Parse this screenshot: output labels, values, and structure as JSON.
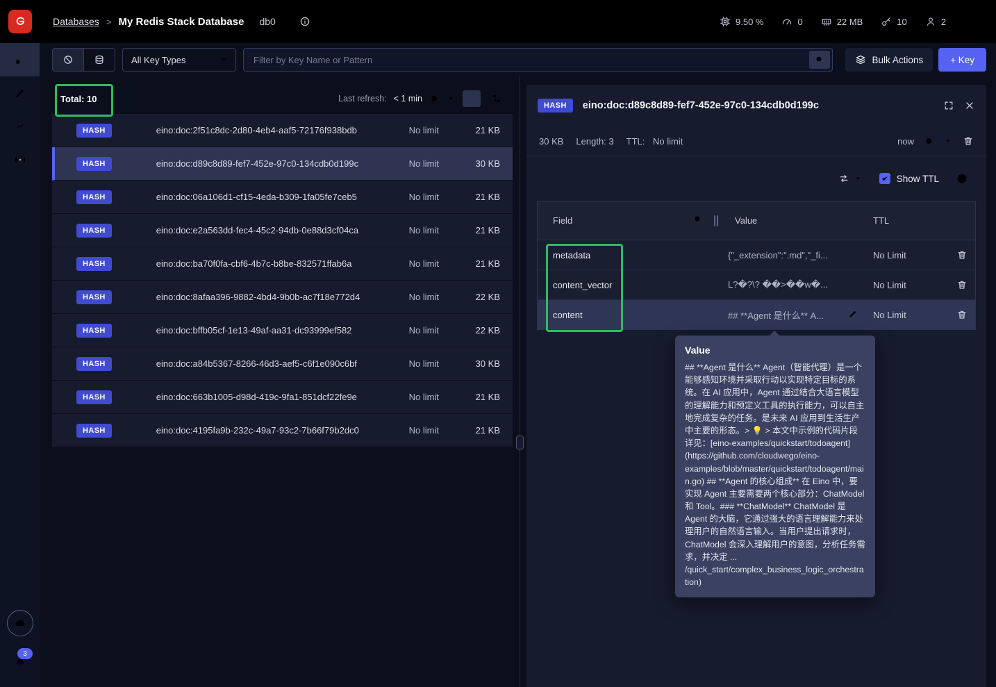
{
  "header": {
    "breadcrumb": {
      "root": "Databases",
      "separator": ">",
      "current": "My Redis Stack Database"
    },
    "db_badge": "db0",
    "metrics": {
      "cpu": "9.50 %",
      "commands": "0",
      "memory": "22 MB",
      "keys": "10",
      "clients": "2"
    }
  },
  "filter_bar": {
    "key_type_selected": "All Key Types",
    "search_placeholder": "Filter by Key Name or Pattern",
    "bulk_actions_label": "Bulk Actions",
    "add_key_label": "+ Key"
  },
  "key_list": {
    "total_label": "Total: 10",
    "last_refresh_label": "Last refresh:",
    "last_refresh_value": "< 1 min",
    "rows": [
      {
        "type": "HASH",
        "name": "eino:doc:2f51c8dc-2d80-4eb4-aaf5-72176f938bdb",
        "ttl": "No limit",
        "size": "21 KB"
      },
      {
        "type": "HASH",
        "name": "eino:doc:d89c8d89-fef7-452e-97c0-134cdb0d199c",
        "ttl": "No limit",
        "size": "30 KB"
      },
      {
        "type": "HASH",
        "name": "eino:doc:06a106d1-cf15-4eda-b309-1fa05fe7ceb5",
        "ttl": "No limit",
        "size": "21 KB"
      },
      {
        "type": "HASH",
        "name": "eino:doc:e2a563dd-fec4-45c2-94db-0e88d3cf04ca",
        "ttl": "No limit",
        "size": "21 KB"
      },
      {
        "type": "HASH",
        "name": "eino:doc:ba70f0fa-cbf6-4b7c-b8be-832571ffab6a",
        "ttl": "No limit",
        "size": "21 KB"
      },
      {
        "type": "HASH",
        "name": "eino:doc:8afaa396-9882-4bd4-9b0b-ac7f18e772d4",
        "ttl": "No limit",
        "size": "22 KB"
      },
      {
        "type": "HASH",
        "name": "eino:doc:bffb05cf-1e13-49af-aa31-dc93999ef582",
        "ttl": "No limit",
        "size": "22 KB"
      },
      {
        "type": "HASH",
        "name": "eino:doc:a84b5367-8266-46d3-aef5-c6f1e090c6bf",
        "ttl": "No limit",
        "size": "30 KB"
      },
      {
        "type": "HASH",
        "name": "eino:doc:663b1005-d98d-419c-9fa1-851dcf22fe9e",
        "ttl": "No limit",
        "size": "21 KB"
      },
      {
        "type": "HASH",
        "name": "eino:doc:4195fa9b-232c-49a7-93c2-7b66f79b2dc0",
        "ttl": "No limit",
        "size": "21 KB"
      }
    ]
  },
  "details": {
    "type_badge": "HASH",
    "key_name": "eino:doc:d89c8d89-fef7-452e-97c0-134cdb0d199c",
    "size": "30 KB",
    "length": "Length: 3",
    "ttl_label": "TTL:",
    "ttl_value": "No limit",
    "refreshed": "now",
    "show_ttl_label": "Show TTL",
    "fields_table": {
      "headers": {
        "field": "Field",
        "value": "Value",
        "ttl": "TTL"
      },
      "rows": [
        {
          "field": "metadata",
          "value": "{\"_extension\":\".md\",\"_fi...",
          "ttl": "No Limit"
        },
        {
          "field": "content_vector",
          "value": "L?�?\\? ��>��w�...",
          "ttl": "No Limit"
        },
        {
          "field": "content",
          "value": "## **Agent 是什么** A...",
          "ttl": "No Limit"
        }
      ]
    },
    "value_tooltip": {
      "title": "Value",
      "body": "## **Agent 是什么** Agent（智能代理）是一个能够感知环境并采取行动以实现特定目标的系统。在 AI 应用中，Agent 通过结合大语言模型的理解能力和预定义工具的执行能力，可以自主地完成复杂的任务。是未来 AI 应用到生活生产中主要的形态。> 💡 > 本文中示例的代码片段详见：[eino-examples/quickstart/todoagent](https://github.com/cloudwego/eino-examples/blob/master/quickstart/todoagent/main.go) ## **Agent 的核心组成** 在 Eino 中，要实现 Agent 主要需要两个核心部分：ChatModel 和 Tool。### **ChatModel** ChatModel 是 Agent 的大脑，它通过强大的语言理解能力来处理用户的自然语言输入。当用户提出请求时，ChatModel 会深入理解用户的意图，分析任务需求，并决定 ... /quick_start/complex_business_logic_orchestration)"
    }
  },
  "sidebar": {
    "notification_count": "3"
  },
  "colors": {
    "accent": "#5562f2",
    "hash_badge": "#404bd0",
    "annotation_green": "#2dbd5f",
    "tooltip_bg": "#3b4160"
  }
}
